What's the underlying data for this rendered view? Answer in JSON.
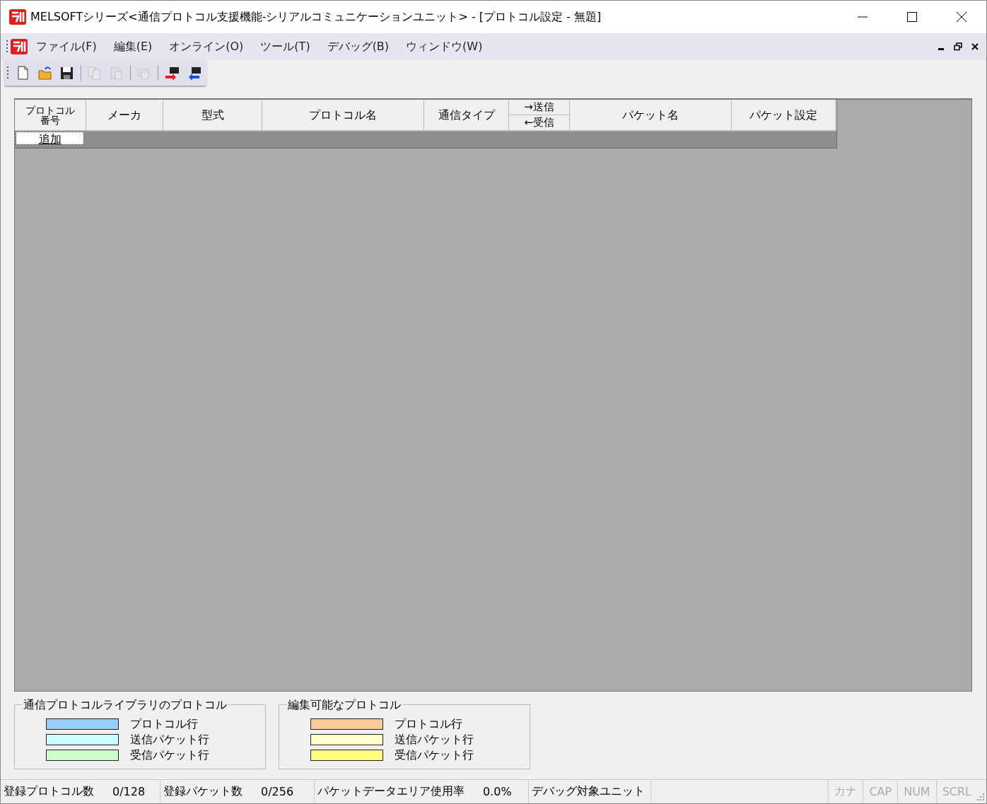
{
  "window": {
    "title": "MELSOFTシリーズ<通信プロトコル支援機能-シリアルコミュニケーションユニット> - [プロトコル設定 - 無題]"
  },
  "menu": [
    "ファイル(F)",
    "編集(E)",
    "オンライン(O)",
    "ツール(T)",
    "デバッグ(B)",
    "ウィンドウ(W)"
  ],
  "toolbar": [
    {
      "kind": "new",
      "disabled": false
    },
    {
      "kind": "open",
      "disabled": false
    },
    {
      "kind": "save",
      "disabled": false
    },
    {
      "kind": "separator"
    },
    {
      "kind": "copy",
      "disabled": true
    },
    {
      "kind": "paste",
      "disabled": true
    },
    {
      "kind": "separator"
    },
    {
      "kind": "print",
      "disabled": true
    },
    {
      "kind": "separator"
    },
    {
      "kind": "write",
      "disabled": false
    },
    {
      "kind": "read",
      "disabled": false
    }
  ],
  "table": {
    "columns": [
      {
        "kind": "single",
        "label": "プロトコル番号"
      },
      {
        "kind": "single",
        "label": "メーカ"
      },
      {
        "kind": "single",
        "label": "型式"
      },
      {
        "kind": "single",
        "label": "プロトコル名"
      },
      {
        "kind": "single",
        "label": "通信タイプ"
      },
      {
        "kind": "split",
        "label": "→送信",
        "label2": "←受信"
      },
      {
        "kind": "single",
        "label": "パケット名"
      },
      {
        "kind": "single",
        "label": "パケット設定"
      }
    ],
    "add_row": "追加"
  },
  "legends": [
    {
      "title": "通信プロトコルライブラリのプロトコル",
      "items": [
        {
          "label": "プロトコル行",
          "color": "#99ccff"
        },
        {
          "label": "送信パケット行",
          "color": "#ccffff"
        },
        {
          "label": "受信パケット行",
          "color": "#ccffcc"
        }
      ]
    },
    {
      "title": "編集可能なプロトコル",
      "items": [
        {
          "label": "プロトコル行",
          "color": "#ffcc99"
        },
        {
          "label": "送信パケット行",
          "color": "#ffffcc"
        },
        {
          "label": "受信パケット行",
          "color": "#ffff80"
        }
      ]
    }
  ],
  "status_bar": {
    "fields": [
      {
        "label": "登録プロトコル数",
        "value": "0/128"
      },
      {
        "label": "登録パケット数",
        "value": "0/256"
      },
      {
        "label": "パケットデータエリア使用率",
        "value": "0.0%"
      },
      {
        "label": "デバッグ対象ユニット"
      }
    ],
    "indicators": [
      {
        "label": "カナ",
        "on": false
      },
      {
        "label": "CAP",
        "on": false
      },
      {
        "label": "NUM",
        "on": false
      },
      {
        "label": "SCRL",
        "on": false
      }
    ]
  }
}
